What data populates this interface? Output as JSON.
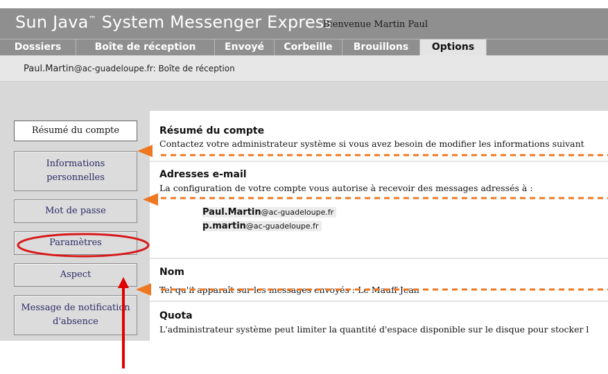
{
  "header": {
    "app_title": "Sun Java",
    "app_title_mark": "™",
    "app_title_rest": " System Messenger Express",
    "welcome": "Bienvenue Martin  Paul"
  },
  "tabs": [
    {
      "label": "Dossiers",
      "active": false
    },
    {
      "label": "Boîte de réception",
      "active": false
    },
    {
      "label": "Envoyé",
      "active": false
    },
    {
      "label": "Corbeille",
      "active": false
    },
    {
      "label": "Brouillons",
      "active": false
    },
    {
      "label": "Options",
      "active": true
    }
  ],
  "breadcrumb": {
    "user": "Paul.Martin",
    "domain": "@ac-guadeloupe.fr",
    "location": ": Boîte de réception"
  },
  "sidebar": {
    "items": [
      {
        "label": "Résumé du compte",
        "active": true
      },
      {
        "label_line1": "Informations",
        "label_line2": "personnelles"
      },
      {
        "label": "Mot de passe"
      },
      {
        "label": "Paramètres",
        "highlighted": true
      },
      {
        "label": "Aspect"
      },
      {
        "label_line1": "Message de notification",
        "label_line2": "d'absence"
      }
    ]
  },
  "content": {
    "summary": {
      "title": "Résumé du compte",
      "text": "Contactez votre administrateur système si vous avez besoin de modifier les informations suivant"
    },
    "emails": {
      "title": "Adresses e-mail",
      "text": "La configuration de votre compte vous autorise à recevoir des messages adressés à :",
      "addresses": [
        {
          "user": "Paul.Martin",
          "domain": "@ac-guadeloupe.fr"
        },
        {
          "user": "p.martin",
          "domain": "@ac-guadeloupe.fr"
        }
      ]
    },
    "name": {
      "title": "Nom",
      "text": "Tel qu'il apparaît sur les messages envoyés : Le Mauff Jean"
    },
    "quota": {
      "title": "Quota",
      "text": "L'administrateur système peut limiter la quantité d'espace disponible sur le disque pour stocker l"
    }
  },
  "colors": {
    "header_bg": "#8f8f8f",
    "annotation_orange": "#ee7722",
    "annotation_red": "#e00000"
  }
}
